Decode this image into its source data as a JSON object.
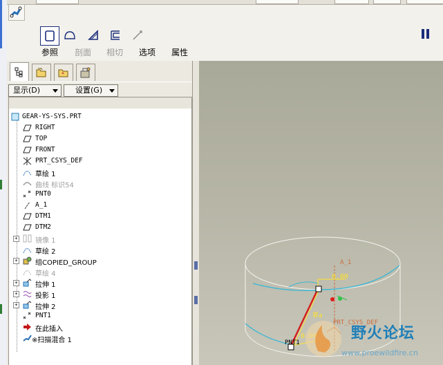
{
  "dashboard": {
    "buttons": [
      {
        "label": "参照",
        "state": "enabled"
      },
      {
        "label": "剖面",
        "state": "disabled"
      },
      {
        "label": "相切",
        "state": "disabled"
      },
      {
        "label": "选项",
        "state": "enabled"
      },
      {
        "label": "属性",
        "state": "enabled"
      }
    ]
  },
  "panel": {
    "show_menu": "显示(D)",
    "settings_menu": "设置(G)"
  },
  "tree": {
    "root": "GEAR-YS-SYS.PRT",
    "items": [
      {
        "label": "RIGHT",
        "icon": "datum-plane-icon"
      },
      {
        "label": "TOP",
        "icon": "datum-plane-icon"
      },
      {
        "label": "FRONT",
        "icon": "datum-plane-icon"
      },
      {
        "label": "PRT_CSYS_DEF",
        "icon": "csys-icon"
      },
      {
        "label": "草绘 1",
        "icon": "sketch-icon"
      },
      {
        "label": "曲线 标识54",
        "icon": "curve-icon",
        "suppressed": true
      },
      {
        "label": "PNT0",
        "icon": "datum-point-icon"
      },
      {
        "label": "A_1",
        "icon": "datum-axis-icon"
      },
      {
        "label": "DTM1",
        "icon": "datum-plane-icon"
      },
      {
        "label": "DTM2",
        "icon": "datum-plane-icon"
      },
      {
        "label": "镜像 1",
        "icon": "mirror-icon",
        "suppressed": true,
        "expandable": true
      },
      {
        "label": "草绘 2",
        "icon": "sketch-icon"
      },
      {
        "label": "组COPIED_GROUP",
        "icon": "group-icon",
        "expandable": true
      },
      {
        "label": "草绘 4",
        "icon": "sketch-icon",
        "suppressed": true
      },
      {
        "label": "拉伸 1",
        "icon": "extrude-icon",
        "expandable": true
      },
      {
        "label": "投影 1",
        "icon": "projection-icon",
        "expandable": true
      },
      {
        "label": "拉伸 2",
        "icon": "extrude-icon",
        "expandable": true
      },
      {
        "label": "PNT1",
        "icon": "datum-point-icon"
      },
      {
        "label": "在此插入",
        "icon": "insert-arrow-icon"
      },
      {
        "label": "※扫描混合 1",
        "icon": "swept-blend-icon"
      }
    ]
  },
  "graphics": {
    "axis_label": "A_1",
    "dimension_top": "0.00",
    "dimension_bottom": "0.00",
    "csys_label": "PRT_CSYS_DEF",
    "point_label": "PNT1",
    "sketch_label": "草a"
  },
  "watermark": {
    "title": "野火论坛",
    "url": "www.proewildfire.cn"
  },
  "colors": {
    "accent_blue": "#1a2d7a",
    "curve_cyan": "#38b7d6",
    "trajectory_red": "#d22020",
    "dimension_yellow": "#ffe22a"
  }
}
